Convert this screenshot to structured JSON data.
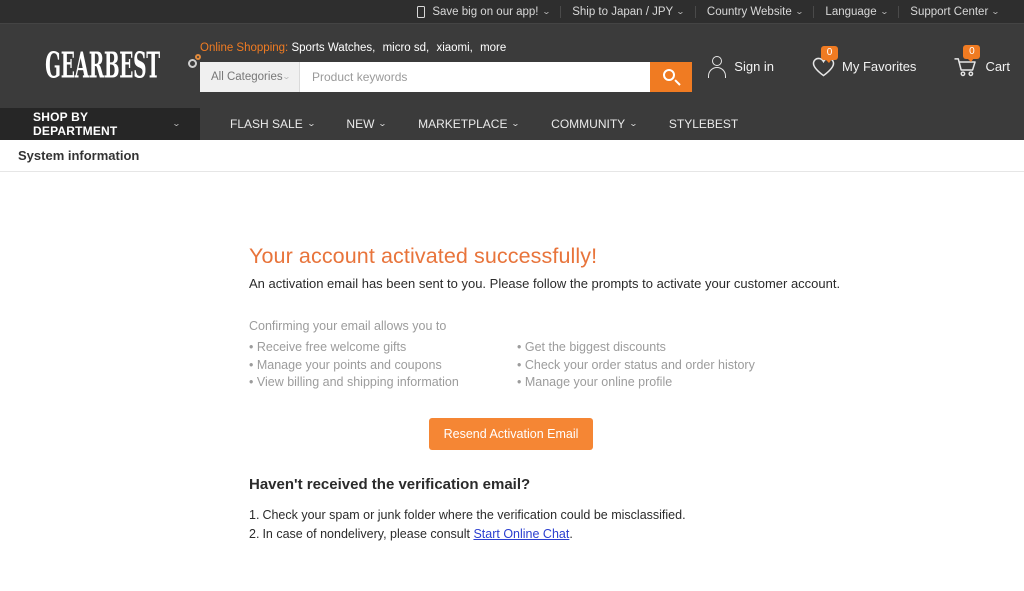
{
  "topbar": {
    "items": [
      {
        "label": "Save big on our app!",
        "icon": "phone-icon",
        "caret": "⌄"
      },
      {
        "label": "Ship to Japan / JPY",
        "caret": "⌄"
      },
      {
        "label": "Country Website",
        "caret": "⌄"
      },
      {
        "label": "Language",
        "caret": "⌄"
      },
      {
        "label": "Support Center",
        "caret": "⌄"
      }
    ]
  },
  "header": {
    "logo": "GEARBEST",
    "promo": {
      "label": "Online Shopping:",
      "links": [
        "Sports Watches,",
        "micro sd,",
        "xiaomi,",
        "more"
      ]
    },
    "search": {
      "category": "All Categories",
      "category_caret": "⌄",
      "placeholder": "Product keywords",
      "value": "",
      "button_icon": "search-icon"
    },
    "actions": {
      "signin": {
        "label": "Sign in",
        "icon": "user-icon"
      },
      "favorites": {
        "label": "My Favorites",
        "icon": "heart-icon",
        "count": "0"
      },
      "cart": {
        "label": "Cart",
        "icon": "cart-icon",
        "count": "0"
      }
    }
  },
  "nav": {
    "department": {
      "label": "SHOP BY DEPARTMENT",
      "caret": "⌄"
    },
    "items": [
      {
        "label": "FLASH SALE",
        "caret": "⌄"
      },
      {
        "label": "NEW",
        "caret": "⌄"
      },
      {
        "label": "MARKETPLACE",
        "caret": "⌄"
      },
      {
        "label": "COMMUNITY",
        "caret": "⌄"
      },
      {
        "label": "STYLEBEST",
        "caret": ""
      }
    ]
  },
  "breadcrumb": {
    "text": "System information"
  },
  "main": {
    "headline": "Your account activated successfully!",
    "subtext": "An activation email has been sent to you. Please follow the prompts to activate your customer account.",
    "benefits": {
      "intro": "Confirming your email allows you to",
      "left": [
        "Receive free welcome gifts",
        "Manage your points and coupons",
        "View billing and shipping information"
      ],
      "right": [
        "Get the biggest discounts",
        "Check your order status and order history",
        "Manage your online profile"
      ]
    },
    "resend_button": "Resend Activation Email",
    "help_heading": "Haven't received the verification email?",
    "steps": [
      {
        "num": "1.",
        "text_before": "Check your spam or junk folder where the verification could be misclassified.",
        "link": "",
        "text_after": ""
      },
      {
        "num": "2.",
        "text_before": "In case of nondelivery, please consult ",
        "link": "Start Online Chat",
        "text_after": "."
      }
    ]
  },
  "colors": {
    "accent_orange": "#f07b22",
    "headline_orange": "#e8743b",
    "button_orange": "#f58634",
    "header_dark": "#3b3b3b",
    "topbar_dark": "#2e2e2e",
    "dept_dark": "#262626",
    "link_blue": "#2b3fd0"
  }
}
